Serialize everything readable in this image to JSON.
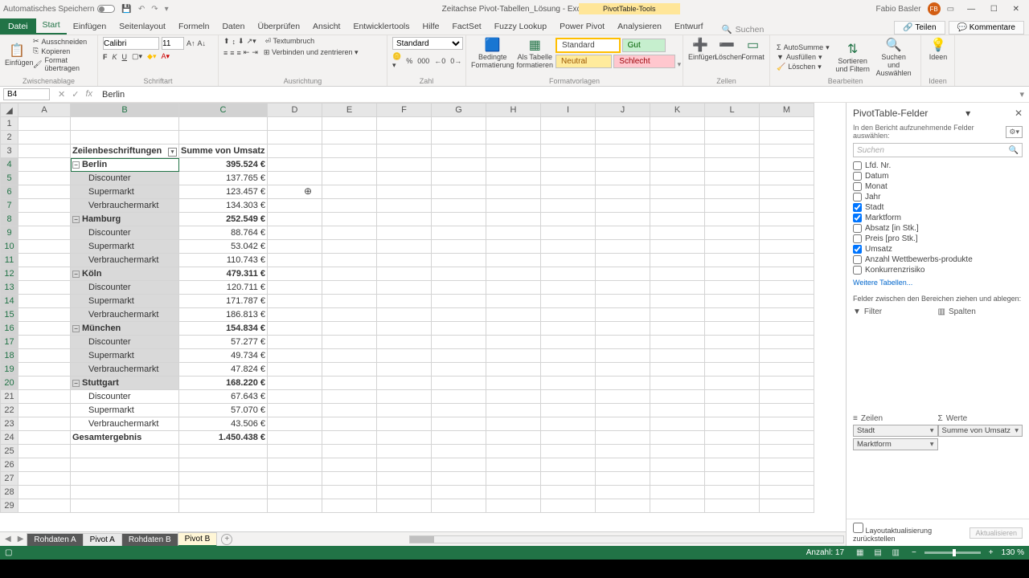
{
  "titlebar": {
    "autosave": "Automatisches Speichern",
    "doc_title": "Zeitachse Pivot-Tabellen_Lösung  -  Excel",
    "pivot_tools": "PivotTable-Tools",
    "user": "Fabio Basler",
    "avatar_initials": "FB"
  },
  "tabs": {
    "file": "Datei",
    "start": "Start",
    "einfuegen": "Einfügen",
    "seitenlayout": "Seitenlayout",
    "formeln": "Formeln",
    "daten": "Daten",
    "ueberpruefen": "Überprüfen",
    "ansicht": "Ansicht",
    "entwicklertools": "Entwicklertools",
    "hilfe": "Hilfe",
    "factset": "FactSet",
    "fuzzy": "Fuzzy Lookup",
    "powerpivot": "Power Pivot",
    "analysieren": "Analysieren",
    "entwurf": "Entwurf",
    "suchen": "Suchen",
    "teilen": "Teilen",
    "kommentare": "Kommentare"
  },
  "ribbon": {
    "einfuegen": "Einfügen",
    "ausschneiden": "Ausschneiden",
    "kopieren": "Kopieren",
    "format_uebertragen": "Format übertragen",
    "zwischenablage": "Zwischenablage",
    "font_name": "Calibri",
    "font_size": "11",
    "schriftart": "Schriftart",
    "textumbruch": "Textumbruch",
    "verbinden": "Verbinden und zentrieren",
    "ausrichtung": "Ausrichtung",
    "zahl_format": "Standard",
    "zahl": "Zahl",
    "bedingte": "Bedingte Formatierung",
    "als_tabelle": "Als Tabelle formatieren",
    "standard": "Standard",
    "gut": "Gut",
    "neutral": "Neutral",
    "schlecht": "Schlecht",
    "formatvorlagen": "Formatvorlagen",
    "zellen_einfuegen": "Einfügen",
    "loeschen": "Löschen",
    "format": "Format",
    "zellen": "Zellen",
    "autosumme": "AutoSumme",
    "ausfuellen": "Ausfüllen",
    "loeschen2": "Löschen",
    "sortieren": "Sortieren und Filtern",
    "suchen_auswaehlen": "Suchen und Auswählen",
    "bearbeiten": "Bearbeiten",
    "ideen": "Ideen"
  },
  "fx": {
    "cell_ref": "B4",
    "formula": "Berlin"
  },
  "columns": [
    "A",
    "B",
    "C",
    "D",
    "E",
    "F",
    "G",
    "H",
    "I",
    "J",
    "K",
    "L",
    "M"
  ],
  "pivot": {
    "header_rows": "Zeilenbeschriftungen",
    "header_vals": "Summe von Umsatz",
    "rows": [
      {
        "type": "city",
        "label": "Berlin",
        "value": "395.524 €",
        "active": true
      },
      {
        "type": "item",
        "label": "Discounter",
        "value": "137.765 €"
      },
      {
        "type": "item",
        "label": "Supermarkt",
        "value": "123.457 €"
      },
      {
        "type": "item",
        "label": "Verbrauchermarkt",
        "value": "134.303 €"
      },
      {
        "type": "city",
        "label": "Hamburg",
        "value": "252.549 €"
      },
      {
        "type": "item",
        "label": "Discounter",
        "value": "88.764 €"
      },
      {
        "type": "item",
        "label": "Supermarkt",
        "value": "53.042 €"
      },
      {
        "type": "item",
        "label": "Verbrauchermarkt",
        "value": "110.743 €"
      },
      {
        "type": "city",
        "label": "Köln",
        "value": "479.311 €"
      },
      {
        "type": "item",
        "label": "Discounter",
        "value": "120.711 €"
      },
      {
        "type": "item",
        "label": "Supermarkt",
        "value": "171.787 €"
      },
      {
        "type": "item",
        "label": "Verbrauchermarkt",
        "value": "186.813 €"
      },
      {
        "type": "city",
        "label": "München",
        "value": "154.834 €"
      },
      {
        "type": "item",
        "label": "Discounter",
        "value": "57.277 €"
      },
      {
        "type": "item",
        "label": "Supermarkt",
        "value": "49.734 €"
      },
      {
        "type": "item",
        "label": "Verbrauchermarkt",
        "value": "47.824 €"
      },
      {
        "type": "city",
        "label": "Stuttgart",
        "value": "168.220 €"
      },
      {
        "type": "item",
        "label": "Discounter",
        "value": "67.643 €"
      },
      {
        "type": "item",
        "label": "Supermarkt",
        "value": "57.070 €"
      },
      {
        "type": "item",
        "label": "Verbrauchermarkt",
        "value": "43.506 €"
      }
    ],
    "total_label": "Gesamtergebnis",
    "total_value": "1.450.438 €"
  },
  "sheets": {
    "rohdaten_a": "Rohdaten A",
    "pivot_a": "Pivot A",
    "rohdaten_b": "Rohdaten B",
    "pivot_b": "Pivot B"
  },
  "ptpane": {
    "title": "PivotTable-Felder",
    "subtitle": "In den Bericht aufzunehmende Felder auswählen:",
    "search_placeholder": "Suchen",
    "fields": [
      {
        "label": "Lfd. Nr.",
        "checked": false
      },
      {
        "label": "Datum",
        "checked": false
      },
      {
        "label": "Monat",
        "checked": false
      },
      {
        "label": "Jahr",
        "checked": false
      },
      {
        "label": "Stadt",
        "checked": true
      },
      {
        "label": "Marktform",
        "checked": true
      },
      {
        "label": "Absatz [in Stk.]",
        "checked": false
      },
      {
        "label": "Preis [pro Stk.]",
        "checked": false
      },
      {
        "label": "Umsatz",
        "checked": true
      },
      {
        "label": "Anzahl Wettbewerbs-produkte",
        "checked": false
      },
      {
        "label": "Konkurrenzrisiko",
        "checked": false
      }
    ],
    "more_tables": "Weitere Tabellen...",
    "areas_label": "Felder zwischen den Bereichen ziehen und ablegen:",
    "area_filter": "Filter",
    "area_columns": "Spalten",
    "area_rows": "Zeilen",
    "area_values": "Werte",
    "row_fields": [
      "Stadt",
      "Marktform"
    ],
    "value_fields": [
      "Summe von Umsatz"
    ],
    "defer": "Layoutaktualisierung zurückstellen",
    "update": "Aktualisieren"
  },
  "status": {
    "anzahl": "Anzahl: 17",
    "zoom": "130 %"
  }
}
